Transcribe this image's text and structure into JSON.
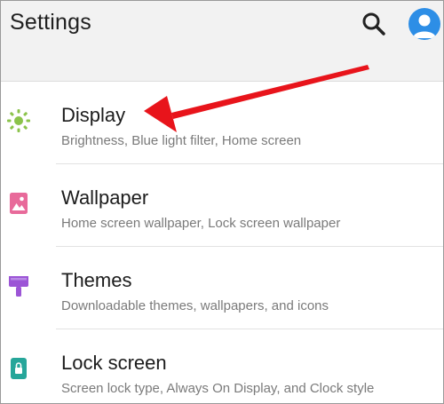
{
  "header": {
    "title": "Settings",
    "search_icon": "search-icon",
    "account_icon": "account-icon",
    "accent_color": "#2d8ee6"
  },
  "settings_list": [
    {
      "label": "Display",
      "subtitle": "Brightness, Blue light filter, Home screen",
      "icon": "brightness-icon",
      "icon_color": "#8bc34a"
    },
    {
      "label": "Wallpaper",
      "subtitle": "Home screen wallpaper, Lock screen wallpaper",
      "icon": "wallpaper-icon",
      "icon_color": "#e86a9a"
    },
    {
      "label": "Themes",
      "subtitle": "Downloadable themes, wallpapers, and icons",
      "icon": "themes-brush-icon",
      "icon_color": "#9c55d6"
    },
    {
      "label": "Lock screen",
      "subtitle": "Screen lock type, Always On Display, and Clock style",
      "icon": "lock-icon",
      "icon_color": "#26a69a"
    }
  ],
  "annotation": {
    "type": "arrow",
    "color": "#e8141b",
    "points_to": "Display"
  }
}
